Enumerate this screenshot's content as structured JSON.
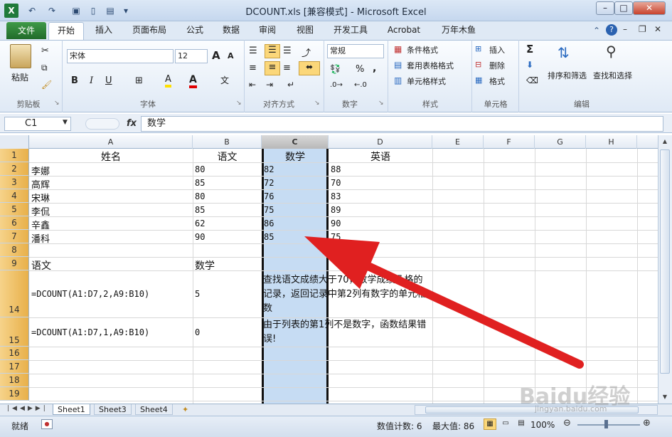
{
  "window": {
    "title": "DCOUNT.xls  [兼容模式] - Microsoft Excel",
    "minimize": "–",
    "restore": "□",
    "close": "✕"
  },
  "qat": {
    "undo": "↶",
    "redo": "↷",
    "save": "▣",
    "open": "▤",
    "more": "▾"
  },
  "ribbon_tabs": [
    "文件",
    "开始",
    "插入",
    "页面布局",
    "公式",
    "数据",
    "审阅",
    "视图",
    "开发工具",
    "Acrobat",
    "万年木鱼"
  ],
  "ribbon_groups": {
    "clipboard": "剪贴板",
    "font": "字体",
    "alignment": "对齐方式",
    "number": "数字",
    "styles": "样式",
    "cells": "单元格",
    "editing": "编辑"
  },
  "clipboard": {
    "paste": "粘贴"
  },
  "font": {
    "name": "宋体",
    "size": "12",
    "bold": "B",
    "italic": "I",
    "underline": "U",
    "grow": "A",
    "shrink": "A",
    "color": "A",
    "highlight": "A"
  },
  "number": {
    "format": "常规",
    "percent": "%",
    "comma": ","
  },
  "styles": {
    "conditional": "条件格式",
    "table": "套用表格格式",
    "cell": "单元格样式"
  },
  "cells": {
    "insert": "插入",
    "delete": "删除",
    "format": "格式"
  },
  "editing": {
    "sum": "Σ",
    "sort": "排序和筛选",
    "find": "查找和选择"
  },
  "formula_bar": {
    "name_box": "C1",
    "fx": "fx",
    "content": "数学"
  },
  "columns": [
    "A",
    "B",
    "C",
    "D",
    "E",
    "F",
    "G",
    "H"
  ],
  "rows": [
    "1",
    "2",
    "3",
    "4",
    "5",
    "6",
    "7",
    "8",
    "9",
    "14",
    "15",
    "16",
    "17",
    "18",
    "19"
  ],
  "cells_data": {
    "header": [
      "姓名",
      "语文",
      "数学",
      "英语"
    ],
    "data": [
      [
        "李娜",
        "80",
        "82",
        "88"
      ],
      [
        "高辉",
        "85",
        "72",
        "70"
      ],
      [
        "宋琳",
        "80",
        "76",
        "83"
      ],
      [
        "李侃",
        "85",
        "75",
        "89"
      ],
      [
        "辛鑫",
        "62",
        "86",
        "90"
      ],
      [
        "潘科",
        "90",
        "85",
        "75"
      ]
    ],
    "criteria": [
      "语文",
      "数学"
    ],
    "r14": {
      "formula": "=DCOUNT(A1:D7,2,A9:B10)",
      "result": "5",
      "note": "查找语文成绩大于70，数学成绩及格的记录，返回记录中第2列有数字的单元格数"
    },
    "r15": {
      "formula": "=DCOUNT(A1:D7,1,A9:B10)",
      "result": "0",
      "note": "由于列表的第1列不是数字，函数结果错误!"
    }
  },
  "sheets": [
    "Sheet1",
    "Sheet3",
    "Sheet4"
  ],
  "status": {
    "ready": "就绪",
    "count": "数值计数: 6",
    "max": "最大值: 86",
    "zoom": "100%"
  },
  "watermark": {
    "logo": "Baidu经验",
    "url": "jingyan.baidu.com"
  },
  "colors": {
    "accent": "#217346",
    "selected_column": "#c6dcf3",
    "arrow": "#e02020"
  }
}
